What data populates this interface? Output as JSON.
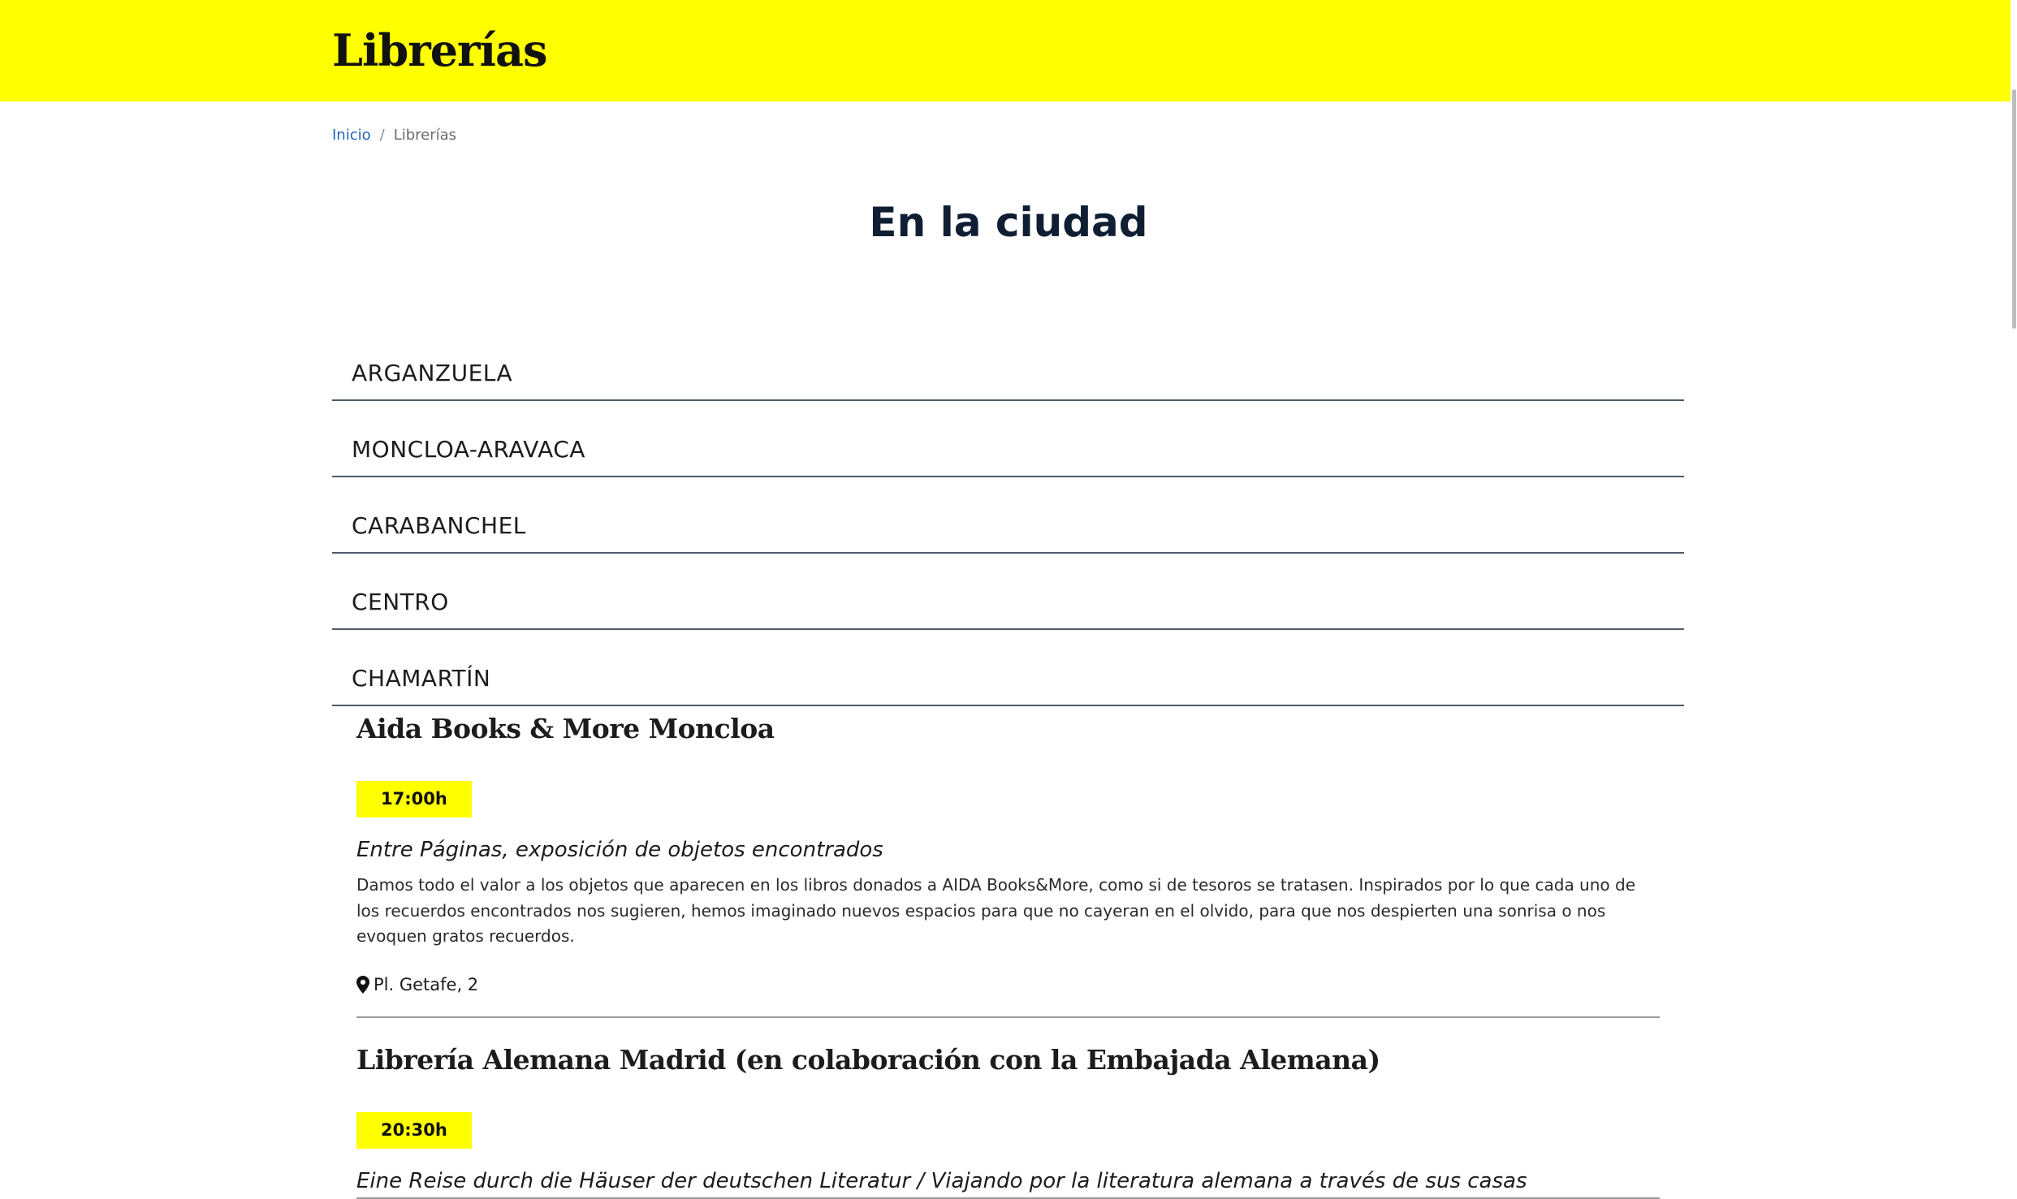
{
  "header": {
    "title": "Librerías",
    "background_color": "#ffff00"
  },
  "breadcrumb": {
    "home_label": "Inicio",
    "separator": "/",
    "current_label": "Librerías"
  },
  "section": {
    "title": "En la ciudad"
  },
  "districts": [
    {
      "label": "ARGANZUELA"
    },
    {
      "label": "MONCLOA-ARAVACA"
    },
    {
      "label": "CARABANCHEL"
    },
    {
      "label": "CENTRO"
    },
    {
      "label": "CHAMARTÍN"
    }
  ],
  "events": [
    {
      "name": "Aida Books & More Moncloa",
      "time": "17:00h",
      "subtitle": "Entre Páginas, exposición de objetos encontrados",
      "description": "Damos todo el valor a los objetos que aparecen en los libros donados a AIDA Books&More, como si de tesoros se tratasen. Inspirados por lo que cada uno de los recuerdos encontrados nos sugieren, hemos imaginado nuevos espacios para que no cayeran en el olvido, para que nos despierten una sonrisa o nos evoquen gratos recuerdos.",
      "location": "Pl. Getafe, 2",
      "location_icon": "map-pin-icon"
    },
    {
      "name": "Librería Alemana Madrid (en colaboración con la Embajada Alemana)",
      "time": "20:30h",
      "subtitle": "Eine Reise durch die Häuser der deutschen Literatur / Viajando por la literatura alemana a través de sus casas"
    }
  ],
  "colors": {
    "accent_yellow": "#ffff00",
    "link_blue": "#1f64b4",
    "title_navy": "#0f1e33"
  }
}
